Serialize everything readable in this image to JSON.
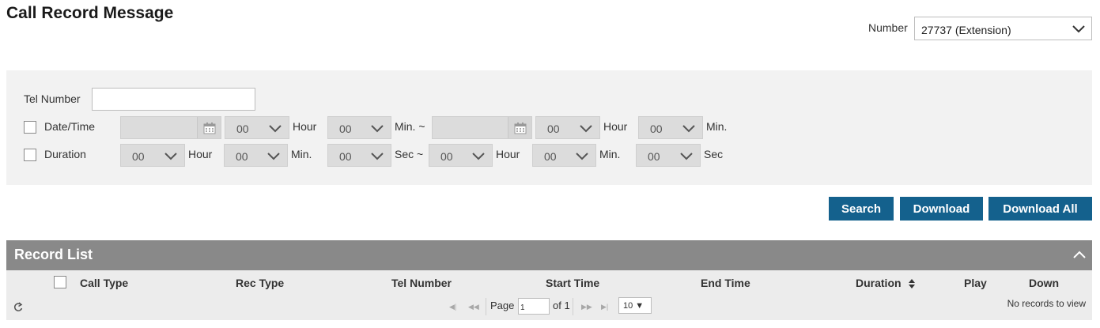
{
  "page": {
    "title": "Call Record Message"
  },
  "number_filter": {
    "label": "Number",
    "selected": "27737 (Extension)"
  },
  "filters": {
    "tel_number": {
      "label": "Tel Number",
      "value": ""
    },
    "datetime": {
      "label": "Date/Time",
      "checked": false,
      "from": {
        "date": "",
        "hour": "00",
        "hour_label": "Hour",
        "min": "00",
        "min_label": "Min. ~"
      },
      "to": {
        "date": "",
        "hour": "00",
        "hour_label": "Hour",
        "min": "00",
        "min_label": "Min."
      }
    },
    "duration": {
      "label": "Duration",
      "checked": false,
      "from": {
        "hour": "00",
        "hour_label": "Hour",
        "min": "00",
        "min_label": "Min.",
        "sec": "00",
        "sec_label": "Sec ~"
      },
      "to": {
        "hour": "00",
        "hour_label": "Hour",
        "min": "00",
        "min_label": "Min.",
        "sec": "00",
        "sec_label": "Sec"
      }
    }
  },
  "actions": {
    "search": "Search",
    "download": "Download",
    "download_all": "Download All"
  },
  "record_list": {
    "title": "Record List",
    "columns": [
      "Call Type",
      "Rec Type",
      "Tel Number",
      "Start Time",
      "End Time",
      "Duration",
      "Play",
      "Down"
    ],
    "pager": {
      "page_label": "Page",
      "page_value": "1",
      "of_label": "of 1",
      "rows_per_page": "10",
      "status": "No records to view"
    }
  },
  "colors": {
    "button": "#14618d",
    "panel_bg": "#f2f2f2",
    "grid_header": "#898989"
  },
  "icons": [
    "chevron-down-icon",
    "calendar-icon",
    "chevron-up-icon",
    "sort-icon",
    "refresh-icon",
    "first-page-icon",
    "prev-page-icon",
    "next-page-icon",
    "last-page-icon"
  ]
}
